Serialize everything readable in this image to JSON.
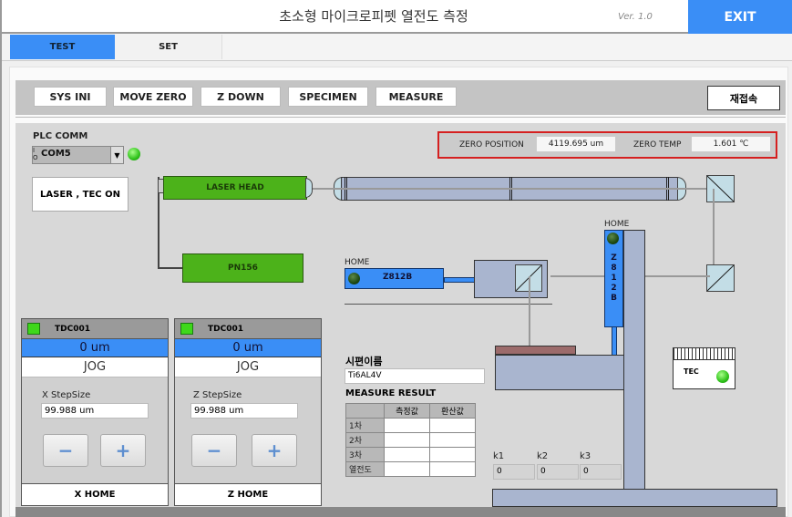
{
  "window": {
    "title": "초소형 마이크로피펫 열전도 측정",
    "version": "Ver. 1.0",
    "exit_label": "EXIT"
  },
  "tabs": [
    {
      "label": "TEST",
      "active": true
    },
    {
      "label": "SET",
      "active": false
    }
  ],
  "toolbar": {
    "buttons": [
      "SYS INI",
      "MOVE ZERO",
      "Z DOWN",
      "SPECIMEN",
      "MEASURE"
    ],
    "reconnect_label": "재접속"
  },
  "plc": {
    "label": "PLC COMM",
    "io_prefix": "I/O",
    "port": "COM5",
    "status": "connected"
  },
  "laser_tec_button": "LASER , TEC ON",
  "zero": {
    "position_label": "ZERO POSITION",
    "position_value": "4119.695 um",
    "temp_label": "ZERO TEMP",
    "temp_value": "1.601 ℃"
  },
  "diagram": {
    "laser_head": "LASER HEAD",
    "pn": "PN156",
    "x_motor": {
      "home_label": "HOME",
      "name": "Z812B"
    },
    "z_motor": {
      "home_label": "HOME",
      "name_chars": [
        "Z",
        "8",
        "1",
        "2",
        "B"
      ]
    },
    "tec_label": "TEC"
  },
  "tdc_panels": [
    {
      "title": "TDC001",
      "position": "0 um",
      "jog": "JOG",
      "step_label": "X StepSize",
      "step_value": "99.988 um",
      "minus": "−",
      "plus": "+",
      "home": "X HOME"
    },
    {
      "title": "TDC001",
      "position": "0 um",
      "jog": "JOG",
      "step_label": "Z StepSize",
      "step_value": "99.988 um",
      "minus": "−",
      "plus": "+",
      "home": "Z HOME"
    }
  ],
  "specimen": {
    "label": "시편이름",
    "value": "Ti6AL4V"
  },
  "measure_result": {
    "title": "MEASURE RESULT",
    "columns": [
      "",
      "측정값",
      "환산값"
    ],
    "rows": [
      {
        "label": "1차",
        "measured": "",
        "converted": ""
      },
      {
        "label": "2차",
        "measured": "",
        "converted": ""
      },
      {
        "label": "3차",
        "measured": "",
        "converted": ""
      },
      {
        "label": "열전도",
        "measured": "",
        "converted": ""
      }
    ]
  },
  "k_values": [
    {
      "label": "k1",
      "value": "0"
    },
    {
      "label": "k2",
      "value": "0"
    },
    {
      "label": "k3",
      "value": "0"
    }
  ]
}
